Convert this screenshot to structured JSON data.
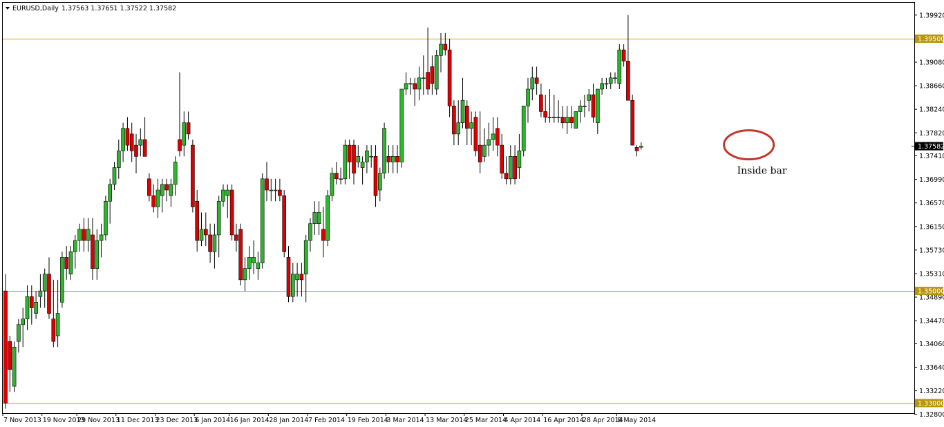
{
  "header": {
    "symbol_timeframe": "EURUSD,Daily",
    "ohlc": "1.37563 1.37651 1.37522 1.37582"
  },
  "chart_data": {
    "type": "candlestick",
    "symbol": "EURUSD",
    "timeframe": "Daily",
    "ylim": [
      1.3282,
      1.4014
    ],
    "grid": false,
    "colors": {
      "bull": "#2fb52f",
      "bear": "#dd0000",
      "wick": "#000000",
      "level_line": "#c8a000",
      "level_label_bg": "#b8960c",
      "current_label_bg": "#000000",
      "annotation": "#c0392b"
    },
    "y_ticks": [
      "1.39920",
      "1.39080",
      "1.38660",
      "1.38240",
      "1.37820",
      "1.37410",
      "1.36990",
      "1.36570",
      "1.36150",
      "1.35730",
      "1.35310",
      "1.34890",
      "1.34470",
      "1.34060",
      "1.33640",
      "1.33220",
      "1.32800"
    ],
    "x_ticks": [
      "7 Nov 2013",
      "19 Nov 2013",
      "29 Nov 2013",
      "11 Dec 2013",
      "23 Dec 2013",
      "6 Jan 2014",
      "16 Jan 2014",
      "28 Jan 2014",
      "7 Feb 2014",
      "19 Feb 2014",
      "3 Mar 2014",
      "13 Mar 2014",
      "25 Mar 2014",
      "4 Apr 2014",
      "16 Apr 2014",
      "28 Apr 2014",
      "8 May 2014"
    ],
    "levels": [
      {
        "value": 1.395,
        "label": "1.39500"
      },
      {
        "value": 1.35,
        "label": "1.35000"
      },
      {
        "value": 1.33,
        "label": "1.33000"
      }
    ],
    "current_price": {
      "value": 1.37582,
      "label": "1.37582"
    },
    "annotations": [
      {
        "text": "Inside bar",
        "candle_index": 172
      }
    ],
    "candles": [
      [
        1.35,
        1.353,
        1.329,
        1.33
      ],
      [
        1.341,
        1.342,
        1.332,
        1.336
      ],
      [
        1.333,
        1.341,
        1.332,
        1.34
      ],
      [
        1.341,
        1.345,
        1.339,
        1.344
      ],
      [
        1.344,
        1.347,
        1.34,
        1.345
      ],
      [
        1.345,
        1.351,
        1.343,
        1.349
      ],
      [
        1.349,
        1.351,
        1.344,
        1.347
      ],
      [
        1.346,
        1.35,
        1.345,
        1.348
      ],
      [
        1.349,
        1.353,
        1.347,
        1.35
      ],
      [
        1.35,
        1.354,
        1.347,
        1.353
      ],
      [
        1.353,
        1.356,
        1.345,
        1.346
      ],
      [
        1.345,
        1.352,
        1.34,
        1.341
      ],
      [
        1.342,
        1.352,
        1.34,
        1.346
      ],
      [
        1.348,
        1.357,
        1.347,
        1.356
      ],
      [
        1.356,
        1.358,
        1.352,
        1.354
      ],
      [
        1.353,
        1.358,
        1.352,
        1.357
      ],
      [
        1.357,
        1.36,
        1.354,
        1.359
      ],
      [
        1.359,
        1.362,
        1.357,
        1.361
      ],
      [
        1.361,
        1.363,
        1.357,
        1.359
      ],
      [
        1.359,
        1.363,
        1.357,
        1.361
      ],
      [
        1.36,
        1.363,
        1.352,
        1.354
      ],
      [
        1.354,
        1.361,
        1.352,
        1.359
      ],
      [
        1.359,
        1.362,
        1.356,
        1.36
      ],
      [
        1.36,
        1.367,
        1.359,
        1.366
      ],
      [
        1.366,
        1.37,
        1.362,
        1.369
      ],
      [
        1.369,
        1.373,
        1.368,
        1.372
      ],
      [
        1.372,
        1.377,
        1.37,
        1.375
      ],
      [
        1.375,
        1.38,
        1.373,
        1.379
      ],
      [
        1.379,
        1.381,
        1.375,
        1.376
      ],
      [
        1.378,
        1.38,
        1.373,
        1.375
      ],
      [
        1.376,
        1.378,
        1.371,
        1.374
      ],
      [
        1.376,
        1.379,
        1.374,
        1.377
      ],
      [
        1.377,
        1.381,
        1.374,
        1.374
      ],
      [
        1.37,
        1.371,
        1.366,
        1.367
      ],
      [
        1.367,
        1.369,
        1.364,
        1.365
      ],
      [
        1.365,
        1.37,
        1.363,
        1.368
      ],
      [
        1.367,
        1.37,
        1.364,
        1.369
      ],
      [
        1.369,
        1.37,
        1.366,
        1.368
      ],
      [
        1.367,
        1.37,
        1.365,
        1.369
      ],
      [
        1.369,
        1.374,
        1.367,
        1.373
      ],
      [
        1.377,
        1.389,
        1.374,
        1.375
      ],
      [
        1.376,
        1.382,
        1.374,
        1.38
      ],
      [
        1.38,
        1.382,
        1.377,
        1.378
      ],
      [
        1.376,
        1.377,
        1.364,
        1.365
      ],
      [
        1.366,
        1.368,
        1.357,
        1.359
      ],
      [
        1.359,
        1.364,
        1.358,
        1.361
      ],
      [
        1.361,
        1.364,
        1.358,
        1.36
      ],
      [
        1.36,
        1.362,
        1.355,
        1.357
      ],
      [
        1.357,
        1.362,
        1.354,
        1.36
      ],
      [
        1.36,
        1.367,
        1.356,
        1.366
      ],
      [
        1.366,
        1.369,
        1.365,
        1.368
      ],
      [
        1.367,
        1.369,
        1.363,
        1.368
      ],
      [
        1.368,
        1.369,
        1.359,
        1.36
      ],
      [
        1.36,
        1.362,
        1.357,
        1.359
      ],
      [
        1.361,
        1.362,
        1.351,
        1.352
      ],
      [
        1.352,
        1.356,
        1.35,
        1.354
      ],
      [
        1.354,
        1.358,
        1.352,
        1.356
      ],
      [
        1.355,
        1.359,
        1.353,
        1.356
      ],
      [
        1.354,
        1.357,
        1.352,
        1.355
      ],
      [
        1.355,
        1.371,
        1.354,
        1.37
      ],
      [
        1.37,
        1.373,
        1.366,
        1.368
      ],
      [
        1.368,
        1.37,
        1.366,
        1.368
      ],
      [
        1.368,
        1.37,
        1.366,
        1.368
      ],
      [
        1.368,
        1.37,
        1.366,
        1.367
      ],
      [
        1.367,
        1.368,
        1.356,
        1.357
      ],
      [
        1.356,
        1.358,
        1.348,
        1.349
      ],
      [
        1.349,
        1.355,
        1.348,
        1.353
      ],
      [
        1.352,
        1.355,
        1.349,
        1.353
      ],
      [
        1.353,
        1.355,
        1.349,
        1.352
      ],
      [
        1.353,
        1.36,
        1.348,
        1.359
      ],
      [
        1.359,
        1.363,
        1.357,
        1.362
      ],
      [
        1.362,
        1.366,
        1.36,
        1.364
      ],
      [
        1.362,
        1.366,
        1.36,
        1.364
      ],
      [
        1.361,
        1.365,
        1.356,
        1.359
      ],
      [
        1.359,
        1.368,
        1.358,
        1.367
      ],
      [
        1.367,
        1.372,
        1.366,
        1.371
      ],
      [
        1.371,
        1.373,
        1.369,
        1.37
      ],
      [
        1.37,
        1.372,
        1.369,
        1.37
      ],
      [
        1.37,
        1.377,
        1.369,
        1.376
      ],
      [
        1.376,
        1.377,
        1.37,
        1.373
      ],
      [
        1.376,
        1.377,
        1.369,
        1.371
      ],
      [
        1.373,
        1.376,
        1.372,
        1.374
      ],
      [
        1.372,
        1.374,
        1.369,
        1.373
      ],
      [
        1.373,
        1.376,
        1.371,
        1.375
      ],
      [
        1.374,
        1.376,
        1.372,
        1.374
      ],
      [
        1.374,
        1.376,
        1.365,
        1.367
      ],
      [
        1.368,
        1.372,
        1.366,
        1.371
      ],
      [
        1.371,
        1.38,
        1.37,
        1.379
      ],
      [
        1.374,
        1.376,
        1.371,
        1.373
      ],
      [
        1.373,
        1.376,
        1.371,
        1.374
      ],
      [
        1.374,
        1.376,
        1.371,
        1.373
      ],
      [
        1.373,
        1.386,
        1.372,
        1.386
      ],
      [
        1.386,
        1.389,
        1.385,
        1.387
      ],
      [
        1.387,
        1.388,
        1.385,
        1.387
      ],
      [
        1.387,
        1.388,
        1.383,
        1.386
      ],
      [
        1.386,
        1.39,
        1.384,
        1.388
      ],
      [
        1.388,
        1.392,
        1.385,
        1.388
      ],
      [
        1.389,
        1.397,
        1.385,
        1.386
      ],
      [
        1.39,
        1.392,
        1.385,
        1.387
      ],
      [
        1.386,
        1.393,
        1.385,
        1.392
      ],
      [
        1.392,
        1.396,
        1.389,
        1.394
      ],
      [
        1.394,
        1.396,
        1.392,
        1.393
      ],
      [
        1.393,
        1.395,
        1.381,
        1.383
      ],
      [
        1.383,
        1.384,
        1.376,
        1.378
      ],
      [
        1.378,
        1.384,
        1.376,
        1.38
      ],
      [
        1.38,
        1.388,
        1.379,
        1.384
      ],
      [
        1.383,
        1.384,
        1.376,
        1.379
      ],
      [
        1.379,
        1.382,
        1.376,
        1.38
      ],
      [
        1.381,
        1.382,
        1.374,
        1.375
      ],
      [
        1.376,
        1.382,
        1.371,
        1.373
      ],
      [
        1.374,
        1.379,
        1.373,
        1.376
      ],
      [
        1.376,
        1.38,
        1.374,
        1.377
      ],
      [
        1.377,
        1.381,
        1.375,
        1.378
      ],
      [
        1.379,
        1.381,
        1.374,
        1.376
      ],
      [
        1.376,
        1.378,
        1.37,
        1.371
      ],
      [
        1.371,
        1.374,
        1.369,
        1.37
      ],
      [
        1.37,
        1.376,
        1.369,
        1.374
      ],
      [
        1.374,
        1.376,
        1.369,
        1.37
      ],
      [
        1.372,
        1.378,
        1.37,
        1.375
      ],
      [
        1.375,
        1.383,
        1.374,
        1.383
      ],
      [
        1.383,
        1.388,
        1.38,
        1.386
      ],
      [
        1.386,
        1.39,
        1.384,
        1.388
      ],
      [
        1.388,
        1.39,
        1.385,
        1.387
      ],
      [
        1.385,
        1.387,
        1.381,
        1.382
      ],
      [
        1.382,
        1.385,
        1.38,
        1.381
      ],
      [
        1.381,
        1.386,
        1.38,
        1.381
      ],
      [
        1.381,
        1.385,
        1.38,
        1.381
      ],
      [
        1.381,
        1.384,
        1.38,
        1.381
      ],
      [
        1.381,
        1.383,
        1.379,
        1.38
      ],
      [
        1.38,
        1.383,
        1.378,
        1.381
      ],
      [
        1.381,
        1.383,
        1.379,
        1.38
      ],
      [
        1.379,
        1.382,
        1.379,
        1.382
      ],
      [
        1.382,
        1.384,
        1.38,
        1.383
      ],
      [
        1.383,
        1.385,
        1.381,
        1.383
      ],
      [
        1.384,
        1.386,
        1.382,
        1.385
      ],
      [
        1.385,
        1.387,
        1.38,
        1.381
      ],
      [
        1.38,
        1.386,
        1.378,
        1.386
      ],
      [
        1.386,
        1.388,
        1.385,
        1.387
      ],
      [
        1.387,
        1.388,
        1.386,
        1.387
      ],
      [
        1.387,
        1.389,
        1.386,
        1.388
      ],
      [
        1.388,
        1.389,
        1.387,
        1.388
      ],
      [
        1.387,
        1.394,
        1.386,
        1.393
      ],
      [
        1.393,
        1.394,
        1.39,
        1.391
      ],
      [
        1.391,
        1.3992,
        1.384,
        1.384
      ],
      [
        1.384,
        1.385,
        1.376,
        1.376
      ],
      [
        1.3756,
        1.376,
        1.374,
        1.375
      ],
      [
        1.37563,
        1.37651,
        1.37522,
        1.37582
      ]
    ]
  }
}
